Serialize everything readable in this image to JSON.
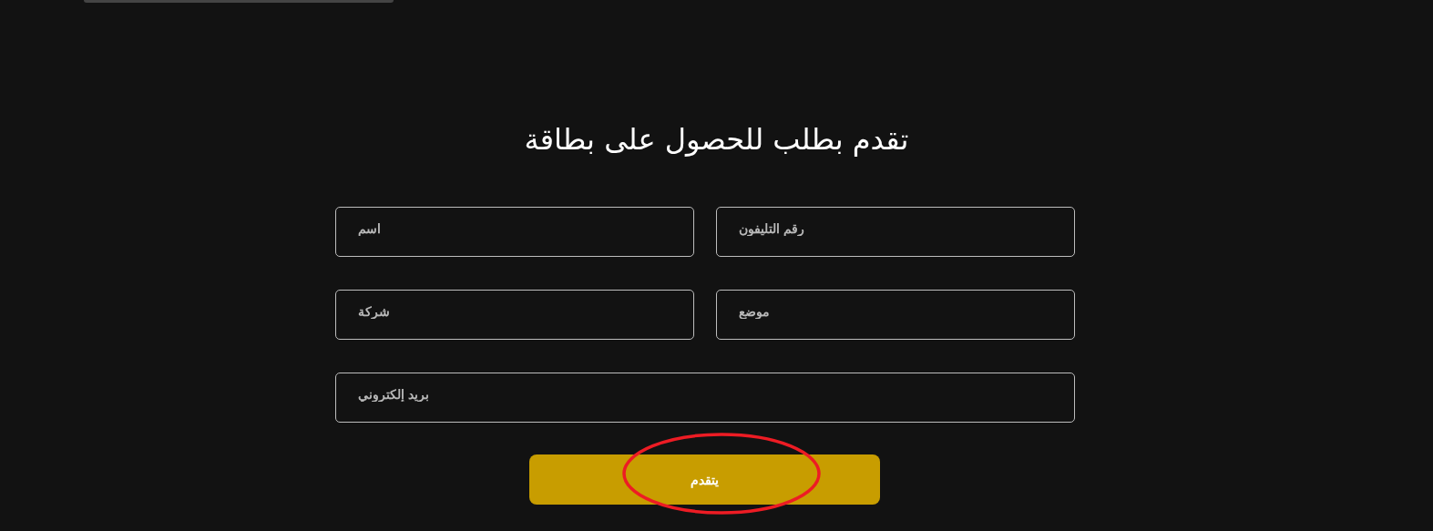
{
  "title": "تقدم بطلب للحصول على بطاقة",
  "fields": [
    {
      "placeholder": "رقم التليفون",
      "wide": false
    },
    {
      "placeholder": "اسم",
      "wide": false
    },
    {
      "placeholder": "موضع",
      "wide": false
    },
    {
      "placeholder": "شركة",
      "wide": false
    },
    {
      "placeholder": "بريد إلكتروني",
      "wide": true
    }
  ],
  "submit": {
    "label": "يتقدم",
    "circled": true
  }
}
